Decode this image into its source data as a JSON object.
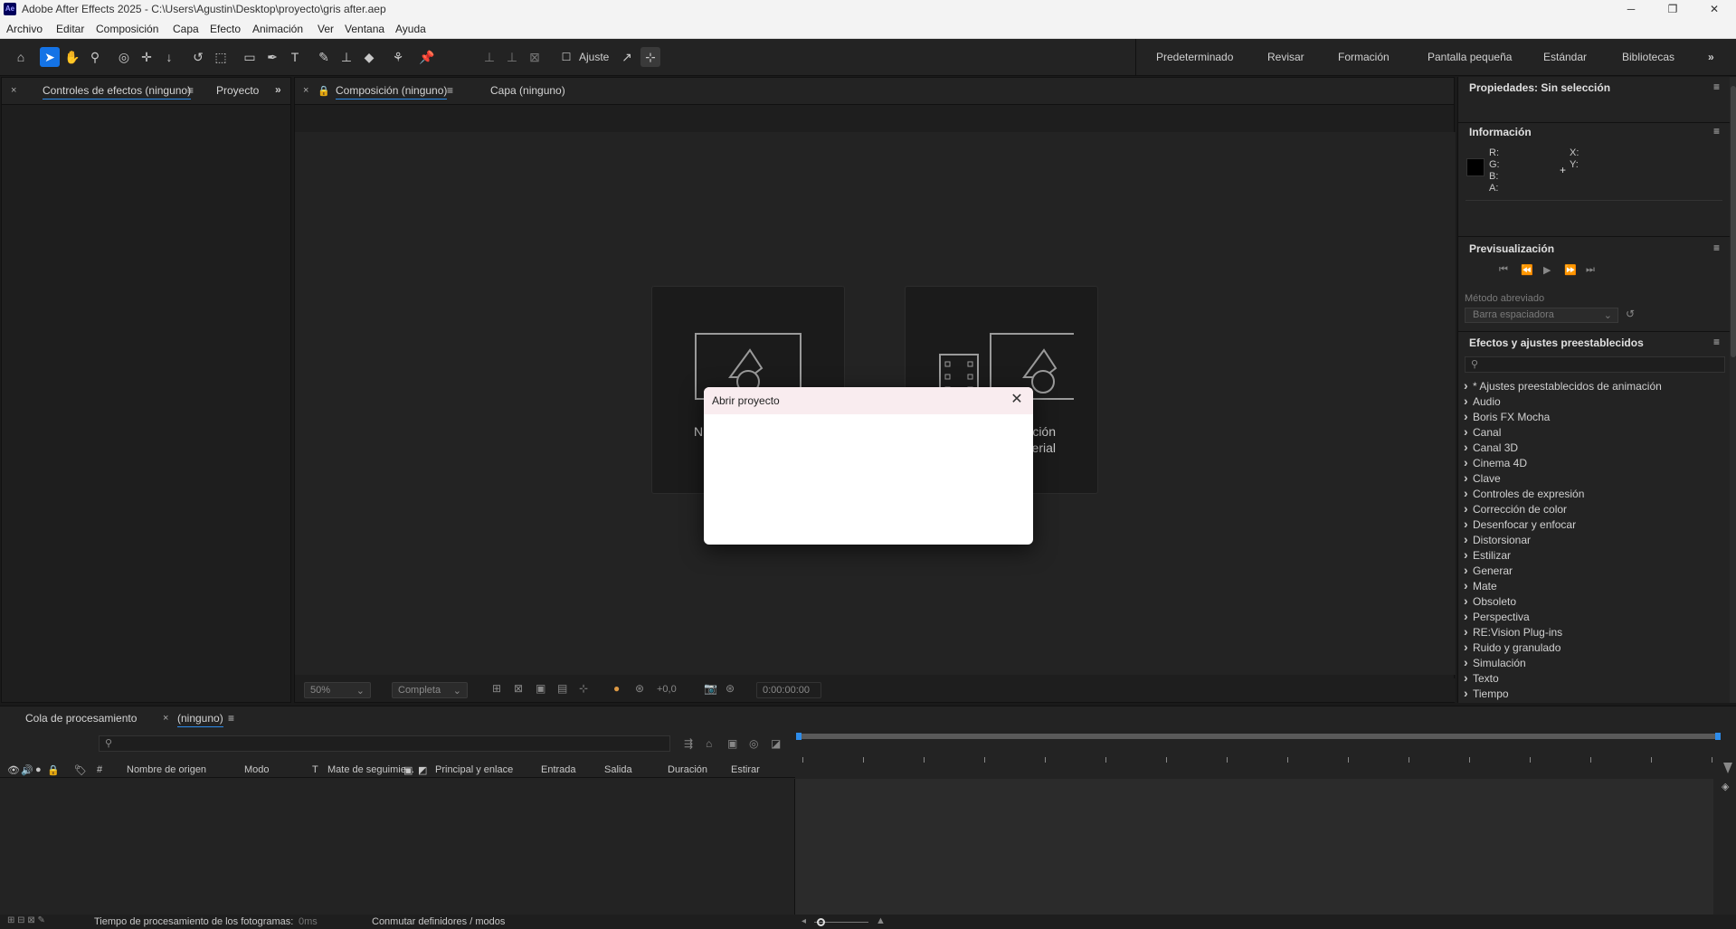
{
  "app": {
    "logo": "Ae",
    "title": "Adobe After Effects 2025 - C:\\Users\\Agustin\\Desktop\\proyecto\\gris after.aep"
  },
  "menu": [
    "Archivo",
    "Editar",
    "Composición",
    "Capa",
    "Efecto",
    "Animación",
    "Ver",
    "Ventana",
    "Ayuda"
  ],
  "toolbar": {
    "snap_label": "Ajuste",
    "workspaces": [
      "Predeterminado",
      "Revisar",
      "Formación",
      "Pantalla pequeña",
      "Estándar",
      "Bibliotecas"
    ]
  },
  "left_panel": {
    "tabs": [
      "Controles de efectos (ninguno)",
      "Proyecto"
    ]
  },
  "comp_panel": {
    "tabs": [
      "Composición (ninguno)",
      "Capa (ninguno)"
    ],
    "card1_label": "N",
    "card2_label_line1": "ción",
    "card2_label_line2": "erial",
    "zoom": "50%",
    "resolution": "Completa",
    "exposure": "+0,0",
    "timecode": "0:00:00:00"
  },
  "dialog": {
    "title": "Abrir proyecto"
  },
  "right_panel": {
    "properties_title": "Propiedades: Sin selección",
    "info_title": "Información",
    "info_labels": [
      "R:",
      "G:",
      "B:",
      "A:"
    ],
    "info_xy": [
      "X:",
      "Y:"
    ],
    "preview_title": "Previsualización",
    "shortcut_label": "Método abreviado",
    "shortcut_value": "Barra espaciadora",
    "effects_title": "Efectos y ajustes preestablecidos",
    "effects": [
      "* Ajustes preestablecidos de animación",
      "Audio",
      "Boris FX Mocha",
      "Canal",
      "Canal 3D",
      "Cinema 4D",
      "Clave",
      "Controles de expresión",
      "Corrección de color",
      "Desenfocar y enfocar",
      "Distorsionar",
      "Estilizar",
      "Generar",
      "Mate",
      "Obsoleto",
      "Perspectiva",
      "RE:Vision Plug-ins",
      "Ruido y granulado",
      "Simulación",
      "Texto",
      "Tiempo"
    ]
  },
  "timeline": {
    "tabs": [
      "Cola de procesamiento",
      "(ninguno)"
    ],
    "columns": [
      "#",
      "Nombre de origen",
      "Modo",
      "T",
      "Mate de seguimie...",
      "Principal y enlace",
      "Entrada",
      "Salida",
      "Duración",
      "Estirar"
    ],
    "status_text": "Tiempo de procesamiento de los fotogramas:",
    "status_value": "0ms",
    "toggle_label": "Conmutar definidores / modos"
  }
}
